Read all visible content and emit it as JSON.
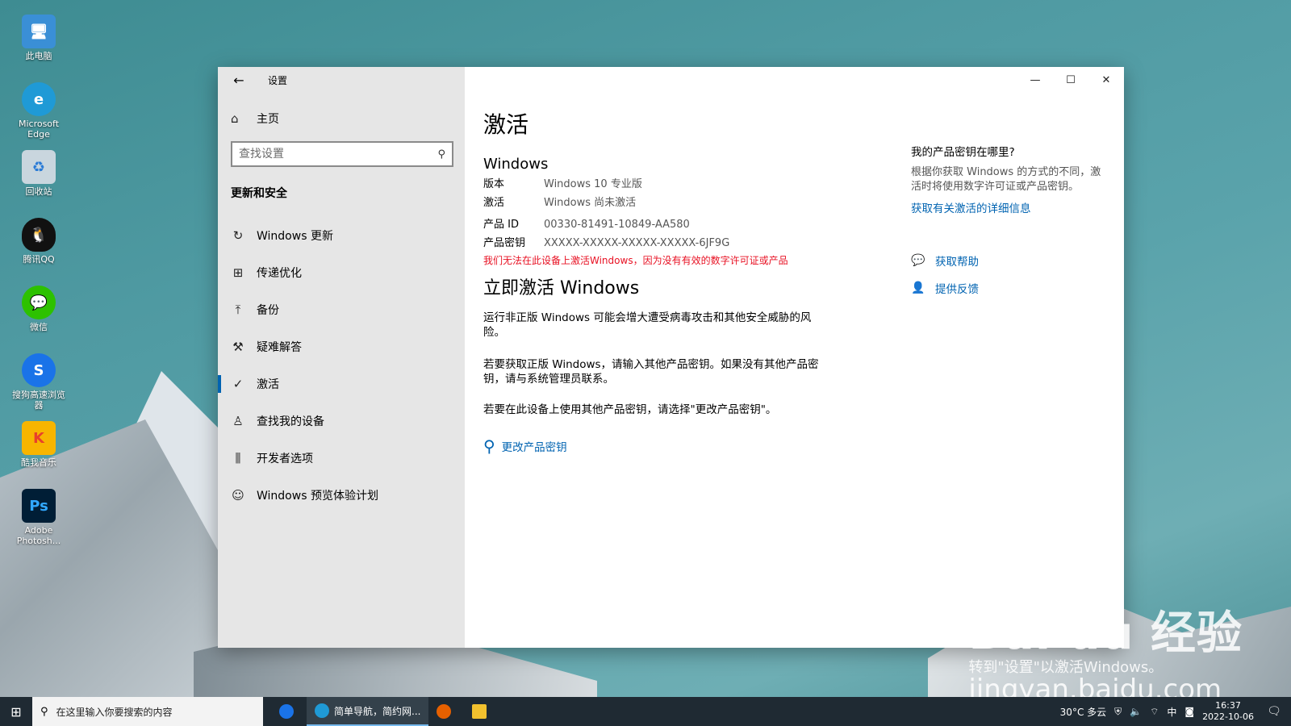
{
  "desktop": {
    "icons": [
      {
        "label": "此电脑",
        "icon": "computer-icon",
        "color": "#3a8fd6"
      },
      {
        "label": "Microsoft Edge",
        "icon": "edge-icon",
        "color": "#1f9ad6"
      },
      {
        "label": "回收站",
        "icon": "recycle-bin-icon",
        "color": "#c9d6de"
      },
      {
        "label": "腾讯QQ",
        "icon": "qq-icon",
        "color": "#111111"
      },
      {
        "label": "微信",
        "icon": "wechat-icon",
        "color": "#2dc100"
      },
      {
        "label": "搜狗高速浏览器",
        "icon": "sogou-browser-icon",
        "color": "#1a73e8"
      },
      {
        "label": "酷我音乐",
        "icon": "kuwo-music-icon",
        "color": "#f7b500"
      },
      {
        "label": "Adobe Photosh...",
        "icon": "photoshop-icon",
        "color": "#001e36"
      }
    ]
  },
  "window": {
    "title": "设置",
    "home_label": "主页",
    "search_placeholder": "查找设置",
    "section_heading": "更新和安全",
    "nav_items": [
      {
        "label": "Windows 更新",
        "icon": "refresh-icon",
        "active": false
      },
      {
        "label": "传递优化",
        "icon": "delivery-icon",
        "active": false
      },
      {
        "label": "备份",
        "icon": "backup-icon",
        "active": false
      },
      {
        "label": "疑难解答",
        "icon": "wrench-icon",
        "active": false
      },
      {
        "label": "激活",
        "icon": "check-circle-icon",
        "active": true
      },
      {
        "label": "查找我的设备",
        "icon": "person-icon",
        "active": false
      },
      {
        "label": "开发者选项",
        "icon": "developer-icon",
        "active": false
      },
      {
        "label": "Windows 预览体验计划",
        "icon": "insider-icon",
        "active": false
      }
    ]
  },
  "activation": {
    "page_title": "激活",
    "windows_heading": "Windows",
    "edition_label": "版本",
    "edition_value": "Windows 10 专业版",
    "activation_label": "激活",
    "activation_value": "Windows 尚未激活",
    "product_id_label": "产品 ID",
    "product_id_value": "00330-81491-10849-AA580",
    "product_key_label": "产品密钥",
    "product_key_value": "XXXXX-XXXXX-XXXXX-XXXXX-6JF9G",
    "error_text": "我们无法在此设备上激活Windows，因为没有有效的数字许可证或产品",
    "activate_heading": "立即激活 Windows",
    "para1": "运行非正版 Windows 可能会增大遭受病毒攻击和其他安全威胁的风险。",
    "para2": "若要获取正版 Windows，请输入其他产品密钥。如果没有其他产品密钥，请与系统管理员联系。",
    "para3": "若要在此设备上使用其他产品密钥，请选择\"更改产品密钥\"。",
    "change_key_label": "更改产品密钥"
  },
  "aside": {
    "heading": "我的产品密钥在哪里?",
    "text": "根据你获取 Windows 的方式的不同，激活时将使用数字许可证或产品密钥。",
    "link": "获取有关激活的详细信息",
    "help_label": "获取帮助",
    "feedback_label": "提供反馈"
  },
  "watermark": {
    "logo": "Bai du 经验",
    "caption": "转到\"设置\"以激活Windows。",
    "url": "jingyan.baidu.com"
  },
  "taskbar": {
    "search_placeholder": "在这里输入你要搜索的内容",
    "active_app_label": "简单导航，简约网...",
    "weather": "30°C 多云",
    "ime": "中",
    "time": "16:37",
    "date": "2022-10-06"
  },
  "colors": {
    "accent": "#0063b1",
    "error": "#e81123",
    "sidebar_bg": "#e6e6e6"
  }
}
